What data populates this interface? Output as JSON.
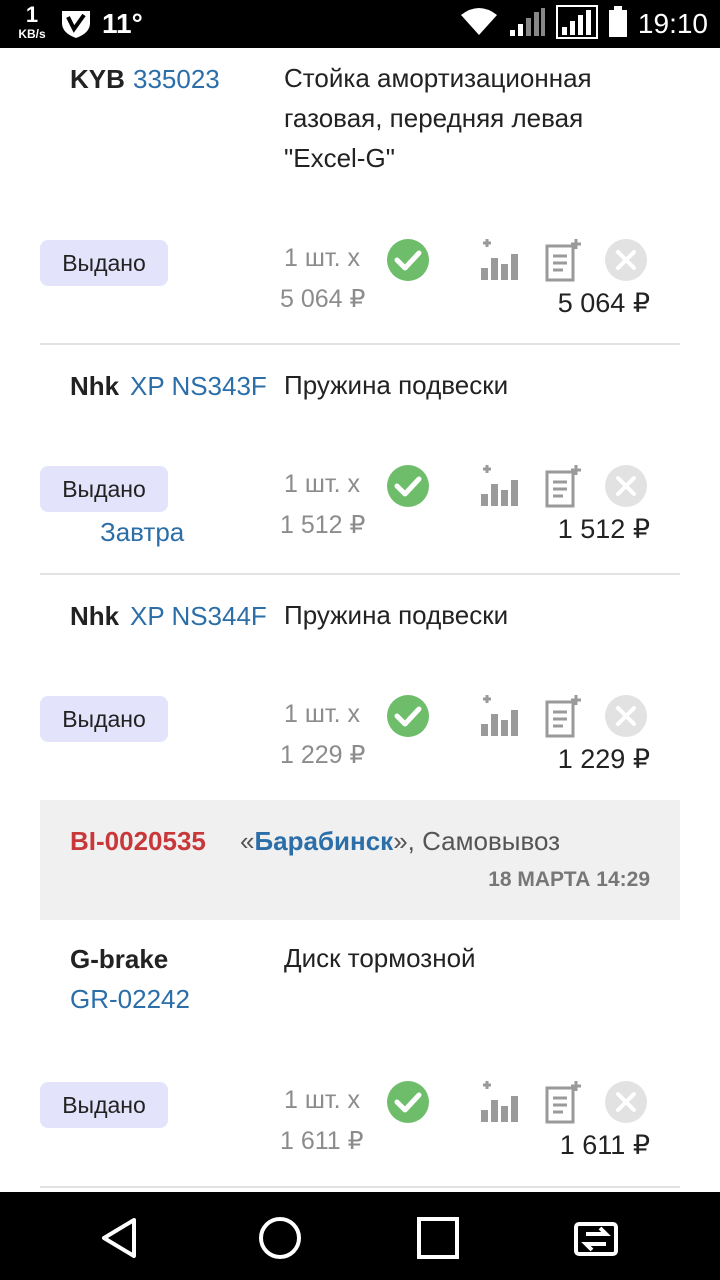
{
  "statusbar": {
    "speed": "1",
    "speed_unit": "KB/s",
    "temperature": "11°",
    "time": "19:10"
  },
  "items": [
    {
      "brand": "KYB",
      "article": "335023",
      "description": "Стойка амортизационная газовая, передняя левая \"Excel-G\"",
      "status": "Выдано",
      "delivery": "",
      "qty": "1 шт. x",
      "unit_price": "5 064 ₽",
      "total": "5 064 ₽"
    },
    {
      "brand": "Nhk",
      "article": "XP NS343F",
      "description": "Пружина подвески",
      "status": "Выдано",
      "delivery": "Завтра",
      "qty": "1 шт. x",
      "unit_price": "1 512 ₽",
      "total": "1 512 ₽"
    },
    {
      "brand": "Nhk",
      "article": "XP NS344F",
      "description": "Пружина подвески",
      "status": "Выдано",
      "delivery": "",
      "qty": "1 шт. x",
      "unit_price": "1 229 ₽",
      "total": "1 229 ₽"
    },
    {
      "brand": "G-brake",
      "article": "GR-02242",
      "description": "Диск тормозной",
      "status": "Выдано",
      "delivery": "",
      "qty": "1 шт. x",
      "unit_price": "1 611 ₽",
      "total": "1 611 ₽"
    }
  ],
  "order": {
    "id": "BI-0020535",
    "quote_open": "«",
    "store": "Барабинск",
    "quote_close": "»",
    "method": ", Самовывоз",
    "date": "18 МАРТА 14:29"
  },
  "colors": {
    "link": "#2b6ea8",
    "order_id": "#c8373a",
    "status_bg": "#e3e3fb",
    "check": "#6dbd6a"
  },
  "icons": [
    "check-icon",
    "stats-icon",
    "note-add-icon",
    "remove-icon"
  ]
}
